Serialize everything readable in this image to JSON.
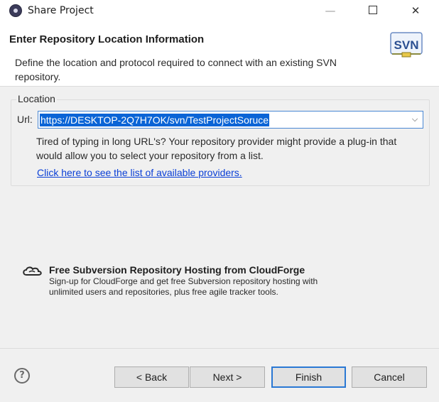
{
  "window": {
    "title": "Share Project",
    "minimize_glyph": "—",
    "close_glyph": "✕"
  },
  "header": {
    "title": "Enter Repository Location Information",
    "description": "Define the location and protocol required to connect with an existing SVN repository.",
    "logo_text": "SVN"
  },
  "location": {
    "group_label": "Location",
    "url_label": "Url:",
    "url_value": "https://DESKTOP-2Q7H7OK/svn/TestProjectSoruce",
    "combo_arrow": "⌵",
    "hint": "Tired of typing in long URL's?  Your repository provider might provide a plug-in that would allow you to select your repository from a list.",
    "providers_link": "Click here to see the list of available providers."
  },
  "cloudforge": {
    "title": "Free Subversion Repository Hosting from CloudForge",
    "description": "Sign-up for CloudForge and get free Subversion repository hosting with unlimited users and repositories, plus free agile tracker tools."
  },
  "footer": {
    "help_glyph": "?",
    "back_label": "< Back",
    "next_label": "Next >",
    "finish_label": "Finish",
    "cancel_label": "Cancel"
  },
  "colors": {
    "selection": "#0a64d6",
    "link": "#0a3fd6",
    "default_button_border": "#2a78d4",
    "panel_background": "#f0f0f0"
  },
  "icons": [
    "app-icon",
    "svn-logo-icon",
    "combo-arrow-icon",
    "cloudforge-icon",
    "help-icon"
  ]
}
